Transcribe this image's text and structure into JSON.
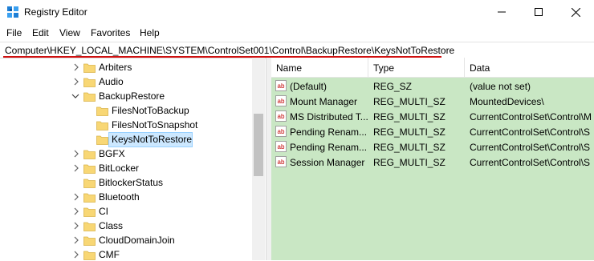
{
  "window": {
    "title": "Registry Editor",
    "controls": {
      "minimize": "minimize-icon",
      "maximize": "maximize-icon",
      "close": "close-icon"
    }
  },
  "menu": [
    "File",
    "Edit",
    "View",
    "Favorites",
    "Help"
  ],
  "address": "Computer\\HKEY_LOCAL_MACHINE\\SYSTEM\\ControlSet001\\Control\\BackupRestore\\KeysNotToRestore",
  "tree": [
    {
      "label": "Arbiters",
      "level": 0,
      "expander": "collapsed"
    },
    {
      "label": "Audio",
      "level": 0,
      "expander": "collapsed"
    },
    {
      "label": "BackupRestore",
      "level": 0,
      "expander": "expanded"
    },
    {
      "label": "FilesNotToBackup",
      "level": 1,
      "expander": "none"
    },
    {
      "label": "FilesNotToSnapshot",
      "level": 1,
      "expander": "none"
    },
    {
      "label": "KeysNotToRestore",
      "level": 1,
      "expander": "none",
      "selected": true
    },
    {
      "label": "BGFX",
      "level": 0,
      "expander": "collapsed"
    },
    {
      "label": "BitLocker",
      "level": 0,
      "expander": "collapsed"
    },
    {
      "label": "BitlockerStatus",
      "level": 0,
      "expander": "none"
    },
    {
      "label": "Bluetooth",
      "level": 0,
      "expander": "collapsed"
    },
    {
      "label": "CI",
      "level": 0,
      "expander": "collapsed"
    },
    {
      "label": "Class",
      "level": 0,
      "expander": "collapsed"
    },
    {
      "label": "CloudDomainJoin",
      "level": 0,
      "expander": "collapsed"
    },
    {
      "label": "CMF",
      "level": 0,
      "expander": "collapsed"
    }
  ],
  "columns": [
    "Name",
    "Type",
    "Data"
  ],
  "values": [
    {
      "name": "(Default)",
      "type": "REG_SZ",
      "data": "(value not set)"
    },
    {
      "name": "Mount Manager",
      "type": "REG_MULTI_SZ",
      "data": "MountedDevices\\"
    },
    {
      "name": "MS Distributed T...",
      "type": "REG_MULTI_SZ",
      "data": "CurrentControlSet\\Control\\M"
    },
    {
      "name": "Pending Renam...",
      "type": "REG_MULTI_SZ",
      "data": "CurrentControlSet\\Control\\S"
    },
    {
      "name": "Pending Renam...",
      "type": "REG_MULTI_SZ",
      "data": "CurrentControlSet\\Control\\S"
    },
    {
      "name": "Session Manager",
      "type": "REG_MULTI_SZ",
      "data": "CurrentControlSet\\Control\\S"
    }
  ],
  "colors": {
    "values_background": "#c9e7c4",
    "selection": "#cce8ff",
    "folder": "#f8d775",
    "address_underline": "#d01010"
  }
}
